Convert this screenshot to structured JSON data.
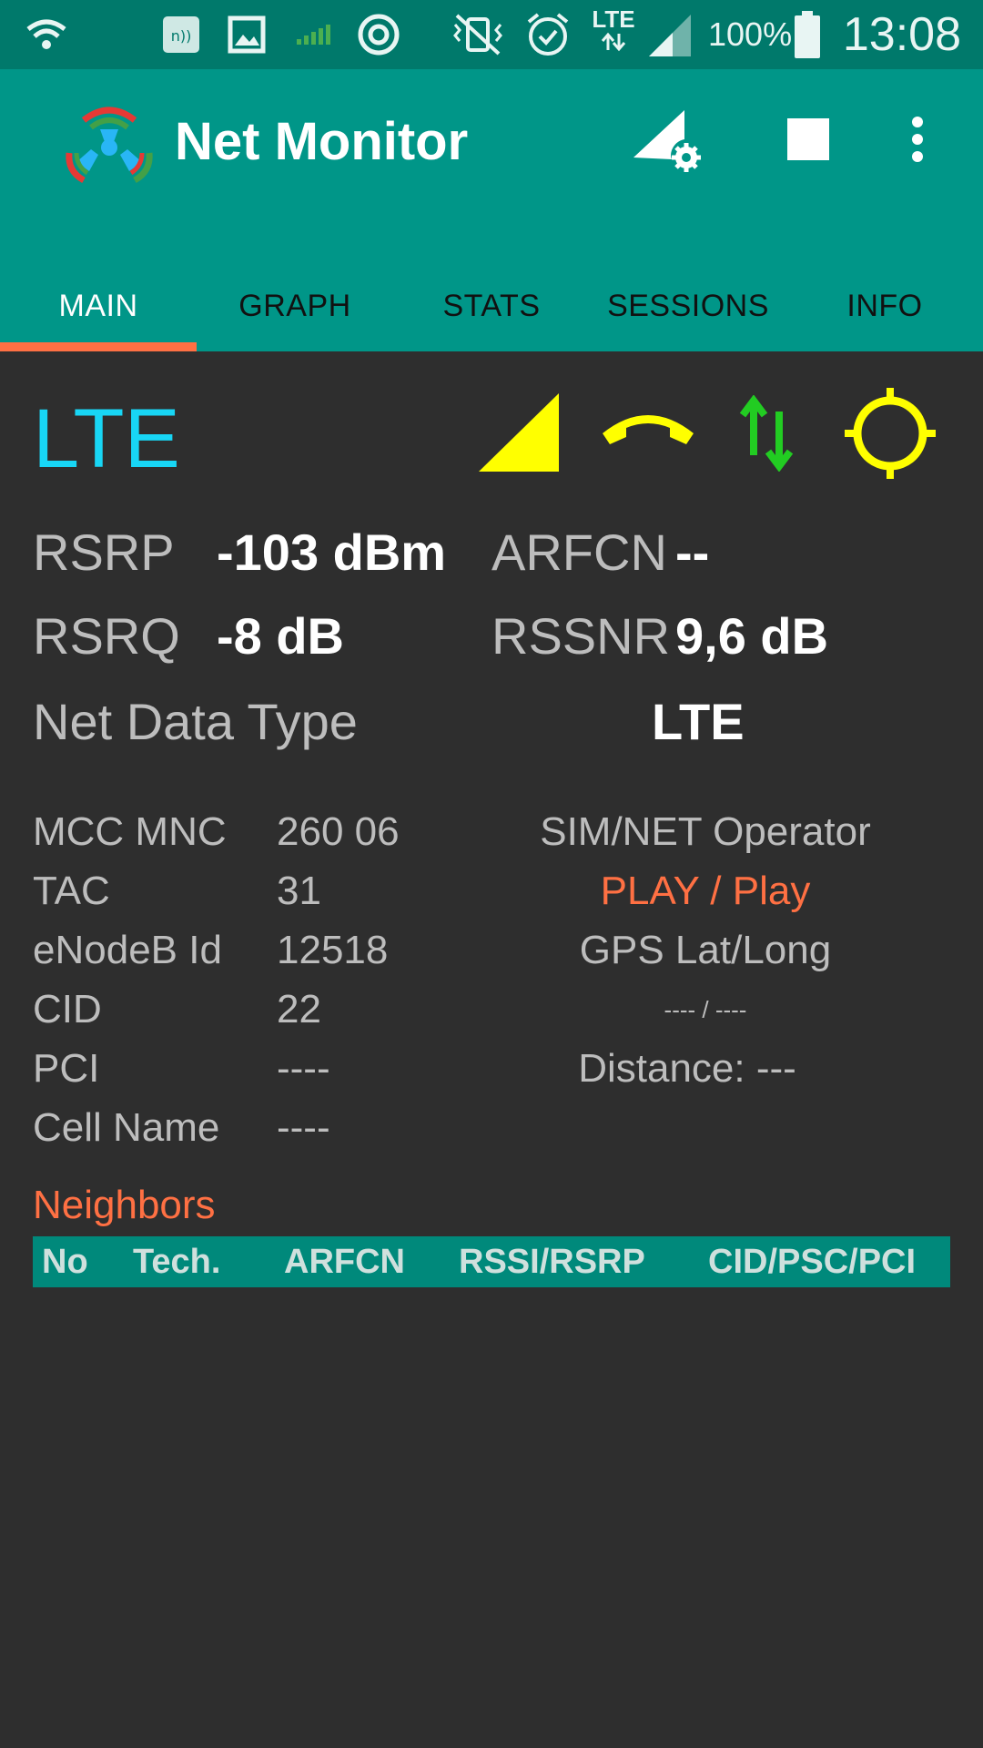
{
  "status_bar": {
    "battery": "100%",
    "network": "LTE",
    "time": "13:08"
  },
  "app": {
    "title": "Net Monitor"
  },
  "tabs": [
    {
      "label": "MAIN",
      "active": true
    },
    {
      "label": "GRAPH",
      "active": false
    },
    {
      "label": "STATS",
      "active": false
    },
    {
      "label": "SESSIONS",
      "active": false
    },
    {
      "label": "INFO",
      "active": false
    }
  ],
  "main": {
    "technology": "LTE",
    "icons": [
      "signal-triangle-icon",
      "phone-handset-icon",
      "data-transfer-arrows-icon",
      "gps-crosshair-icon"
    ],
    "signal": {
      "rsrp_label": "RSRP",
      "rsrp_value": "-103 dBm",
      "arfcn_label": "ARFCN",
      "arfcn_value": "--",
      "rsrq_label": "RSRQ",
      "rsrq_value": "-8 dB",
      "rssnr_label": "RSSNR",
      "rssnr_value": "9,6 dB",
      "net_data_type_label": "Net Data Type",
      "net_data_type_value": "LTE"
    },
    "cell_info": [
      {
        "label": "MCC MNC",
        "value": "260 06"
      },
      {
        "label": "TAC",
        "value": "31"
      },
      {
        "label": "eNodeB Id",
        "value": "12518"
      },
      {
        "label": "CID",
        "value": "22"
      },
      {
        "label": "PCI",
        "value": "----"
      },
      {
        "label": "Cell Name",
        "value": "----"
      }
    ],
    "operator": {
      "label": "SIM/NET Operator",
      "value": "PLAY / Play"
    },
    "gps": {
      "label": "GPS Lat/Long",
      "value": "---- / ----",
      "distance": "Distance: ---"
    },
    "neighbors": {
      "title": "Neighbors",
      "columns": [
        "No",
        "Tech.",
        "ARFCN",
        "RSSI/RSRP",
        "CID/PSC/PCI"
      ]
    }
  },
  "colors": {
    "status_bar": "#00796b",
    "app_bar": "#009688",
    "tab_indicator": "#ff7043",
    "background": "#2e2e2e",
    "tech_label": "#18d6f5",
    "accent_yellow": "#ffff00",
    "accent_green": "#22cc22",
    "operator": "#ff7043",
    "table_header": "#00897b"
  }
}
